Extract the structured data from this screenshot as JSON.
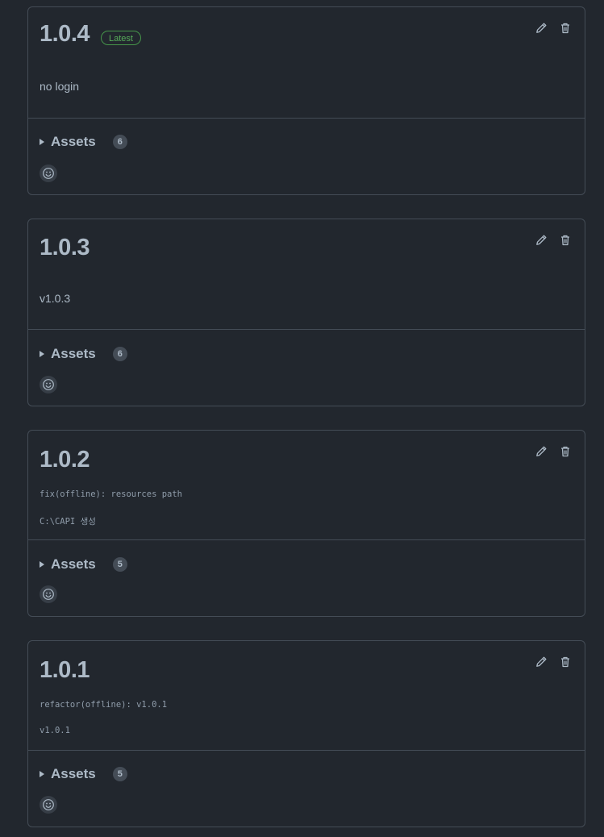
{
  "releases": [
    {
      "version": "1.0.4",
      "latest_badge": "Latest",
      "description_lines": [
        "no login"
      ],
      "description_style": "text",
      "assets_label": "Assets",
      "assets_count": "6"
    },
    {
      "version": "1.0.3",
      "latest_badge": "",
      "description_lines": [
        "v1.0.3"
      ],
      "description_style": "text",
      "assets_label": "Assets",
      "assets_count": "6"
    },
    {
      "version": "1.0.2",
      "latest_badge": "",
      "description_lines": [
        "fix(offline): resources path",
        "C:\\CAPI 생성"
      ],
      "description_style": "mono",
      "assets_label": "Assets",
      "assets_count": "5"
    },
    {
      "version": "1.0.1",
      "latest_badge": "",
      "description_lines": [
        "refactor(offline): v1.0.1",
        "v1.0.1"
      ],
      "description_style": "mono",
      "assets_label": "Assets",
      "assets_count": "5"
    }
  ],
  "icons": {
    "edit": "pencil-icon",
    "delete": "trash-icon",
    "reaction": "smiley-icon",
    "disclosure": "triangle-right-icon"
  },
  "colors": {
    "background": "#22272e",
    "border": "#444c56",
    "text": "#adbac7",
    "latest_green": "#57ab5a"
  }
}
